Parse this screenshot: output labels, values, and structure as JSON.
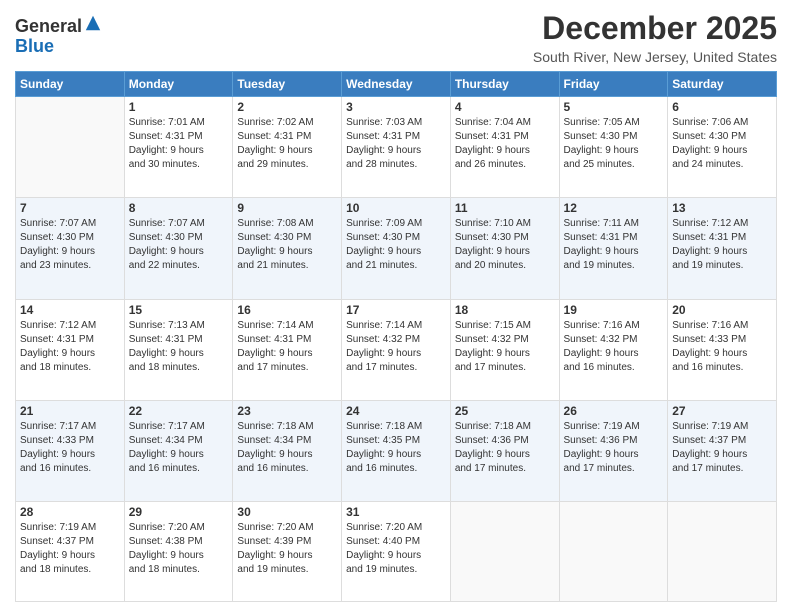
{
  "header": {
    "logo_general": "General",
    "logo_blue": "Blue",
    "main_title": "December 2025",
    "subtitle": "South River, New Jersey, United States"
  },
  "weekdays": [
    "Sunday",
    "Monday",
    "Tuesday",
    "Wednesday",
    "Thursday",
    "Friday",
    "Saturday"
  ],
  "weeks": [
    [
      {
        "num": "",
        "info": ""
      },
      {
        "num": "1",
        "info": "Sunrise: 7:01 AM\nSunset: 4:31 PM\nDaylight: 9 hours\nand 30 minutes."
      },
      {
        "num": "2",
        "info": "Sunrise: 7:02 AM\nSunset: 4:31 PM\nDaylight: 9 hours\nand 29 minutes."
      },
      {
        "num": "3",
        "info": "Sunrise: 7:03 AM\nSunset: 4:31 PM\nDaylight: 9 hours\nand 28 minutes."
      },
      {
        "num": "4",
        "info": "Sunrise: 7:04 AM\nSunset: 4:31 PM\nDaylight: 9 hours\nand 26 minutes."
      },
      {
        "num": "5",
        "info": "Sunrise: 7:05 AM\nSunset: 4:30 PM\nDaylight: 9 hours\nand 25 minutes."
      },
      {
        "num": "6",
        "info": "Sunrise: 7:06 AM\nSunset: 4:30 PM\nDaylight: 9 hours\nand 24 minutes."
      }
    ],
    [
      {
        "num": "7",
        "info": "Sunrise: 7:07 AM\nSunset: 4:30 PM\nDaylight: 9 hours\nand 23 minutes."
      },
      {
        "num": "8",
        "info": "Sunrise: 7:07 AM\nSunset: 4:30 PM\nDaylight: 9 hours\nand 22 minutes."
      },
      {
        "num": "9",
        "info": "Sunrise: 7:08 AM\nSunset: 4:30 PM\nDaylight: 9 hours\nand 21 minutes."
      },
      {
        "num": "10",
        "info": "Sunrise: 7:09 AM\nSunset: 4:30 PM\nDaylight: 9 hours\nand 21 minutes."
      },
      {
        "num": "11",
        "info": "Sunrise: 7:10 AM\nSunset: 4:30 PM\nDaylight: 9 hours\nand 20 minutes."
      },
      {
        "num": "12",
        "info": "Sunrise: 7:11 AM\nSunset: 4:31 PM\nDaylight: 9 hours\nand 19 minutes."
      },
      {
        "num": "13",
        "info": "Sunrise: 7:12 AM\nSunset: 4:31 PM\nDaylight: 9 hours\nand 19 minutes."
      }
    ],
    [
      {
        "num": "14",
        "info": "Sunrise: 7:12 AM\nSunset: 4:31 PM\nDaylight: 9 hours\nand 18 minutes."
      },
      {
        "num": "15",
        "info": "Sunrise: 7:13 AM\nSunset: 4:31 PM\nDaylight: 9 hours\nand 18 minutes."
      },
      {
        "num": "16",
        "info": "Sunrise: 7:14 AM\nSunset: 4:31 PM\nDaylight: 9 hours\nand 17 minutes."
      },
      {
        "num": "17",
        "info": "Sunrise: 7:14 AM\nSunset: 4:32 PM\nDaylight: 9 hours\nand 17 minutes."
      },
      {
        "num": "18",
        "info": "Sunrise: 7:15 AM\nSunset: 4:32 PM\nDaylight: 9 hours\nand 17 minutes."
      },
      {
        "num": "19",
        "info": "Sunrise: 7:16 AM\nSunset: 4:32 PM\nDaylight: 9 hours\nand 16 minutes."
      },
      {
        "num": "20",
        "info": "Sunrise: 7:16 AM\nSunset: 4:33 PM\nDaylight: 9 hours\nand 16 minutes."
      }
    ],
    [
      {
        "num": "21",
        "info": "Sunrise: 7:17 AM\nSunset: 4:33 PM\nDaylight: 9 hours\nand 16 minutes."
      },
      {
        "num": "22",
        "info": "Sunrise: 7:17 AM\nSunset: 4:34 PM\nDaylight: 9 hours\nand 16 minutes."
      },
      {
        "num": "23",
        "info": "Sunrise: 7:18 AM\nSunset: 4:34 PM\nDaylight: 9 hours\nand 16 minutes."
      },
      {
        "num": "24",
        "info": "Sunrise: 7:18 AM\nSunset: 4:35 PM\nDaylight: 9 hours\nand 16 minutes."
      },
      {
        "num": "25",
        "info": "Sunrise: 7:18 AM\nSunset: 4:36 PM\nDaylight: 9 hours\nand 17 minutes."
      },
      {
        "num": "26",
        "info": "Sunrise: 7:19 AM\nSunset: 4:36 PM\nDaylight: 9 hours\nand 17 minutes."
      },
      {
        "num": "27",
        "info": "Sunrise: 7:19 AM\nSunset: 4:37 PM\nDaylight: 9 hours\nand 17 minutes."
      }
    ],
    [
      {
        "num": "28",
        "info": "Sunrise: 7:19 AM\nSunset: 4:37 PM\nDaylight: 9 hours\nand 18 minutes."
      },
      {
        "num": "29",
        "info": "Sunrise: 7:20 AM\nSunset: 4:38 PM\nDaylight: 9 hours\nand 18 minutes."
      },
      {
        "num": "30",
        "info": "Sunrise: 7:20 AM\nSunset: 4:39 PM\nDaylight: 9 hours\nand 19 minutes."
      },
      {
        "num": "31",
        "info": "Sunrise: 7:20 AM\nSunset: 4:40 PM\nDaylight: 9 hours\nand 19 minutes."
      },
      {
        "num": "",
        "info": ""
      },
      {
        "num": "",
        "info": ""
      },
      {
        "num": "",
        "info": ""
      }
    ]
  ]
}
